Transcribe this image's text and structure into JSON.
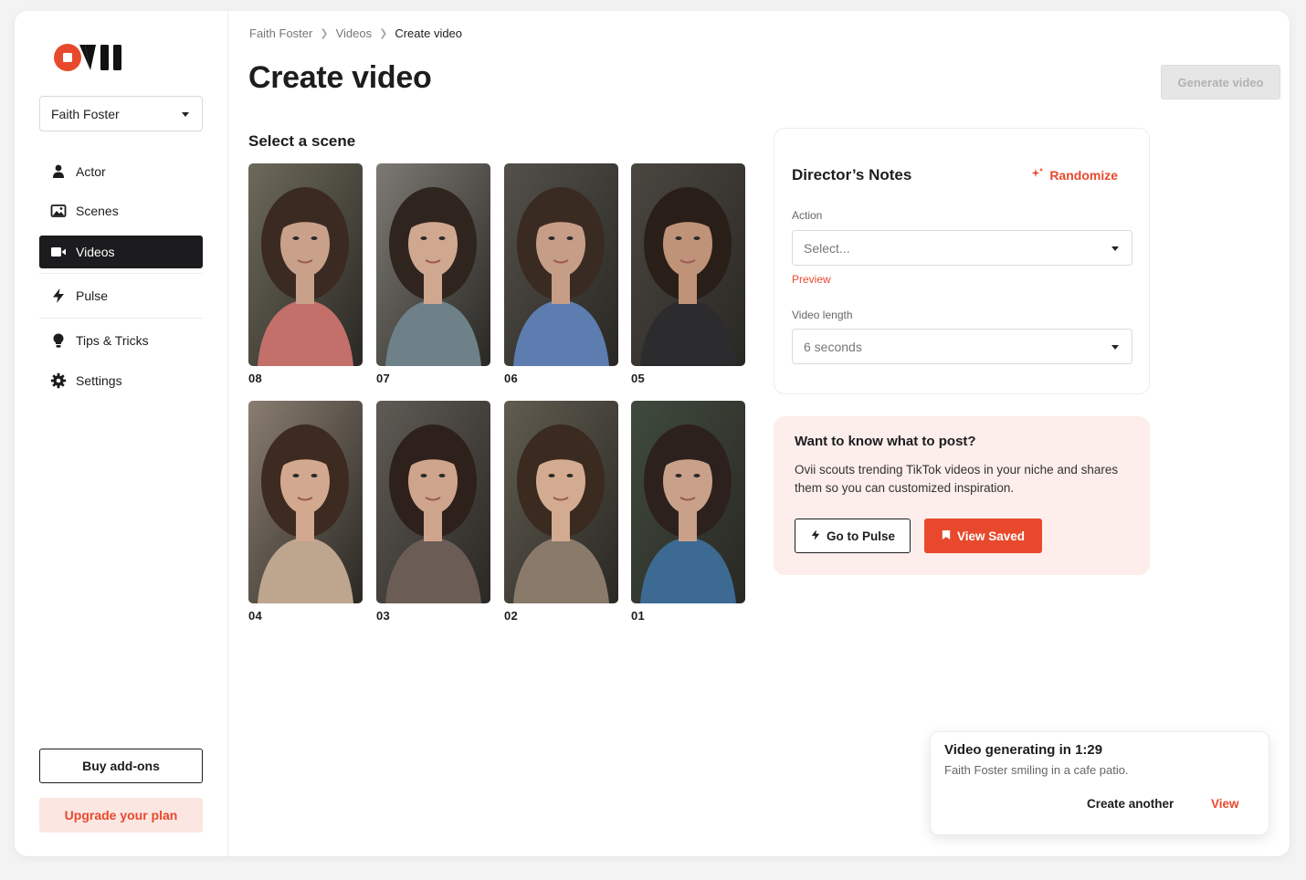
{
  "brand": {
    "accent": "#e8492c",
    "dark": "#1c1c1e"
  },
  "sidebar": {
    "account": "Faith Foster",
    "items": [
      {
        "label": "Actor",
        "icon": "person-icon"
      },
      {
        "label": "Scenes",
        "icon": "image-icon"
      },
      {
        "label": "Videos",
        "icon": "video-camera-icon",
        "active": true
      },
      {
        "label": "Pulse",
        "icon": "lightning-icon"
      },
      {
        "label": "Tips & Tricks",
        "icon": "lightbulb-icon"
      },
      {
        "label": "Settings",
        "icon": "gear-icon"
      }
    ],
    "buy_addons": "Buy add-ons",
    "upgrade": "Upgrade your plan"
  },
  "breadcrumb": [
    "Faith Foster",
    "Videos",
    "Create video"
  ],
  "page": {
    "title": "Create video",
    "generate_button": "Generate video"
  },
  "scenes": {
    "title": "Select a scene",
    "items": [
      "08",
      "07",
      "06",
      "05",
      "04",
      "03",
      "02",
      "01"
    ]
  },
  "notes": {
    "title": "Director’s Notes",
    "randomize": "Randomize",
    "action_label": "Action",
    "action_placeholder": "Select...",
    "preview": "Preview",
    "length_label": "Video length",
    "length_value": "6 seconds"
  },
  "inspiration": {
    "title": "Want to know what to post?",
    "text": "Ovii scouts trending TikTok videos in your niche and shares them so you can customized inspiration.",
    "pulse_button": "Go to Pulse",
    "saved_button": "View Saved"
  },
  "toast": {
    "title": "Video generating in 1:29",
    "subtitle": "Faith Foster smiling in a cafe patio.",
    "create_another": "Create another",
    "view": "View"
  }
}
